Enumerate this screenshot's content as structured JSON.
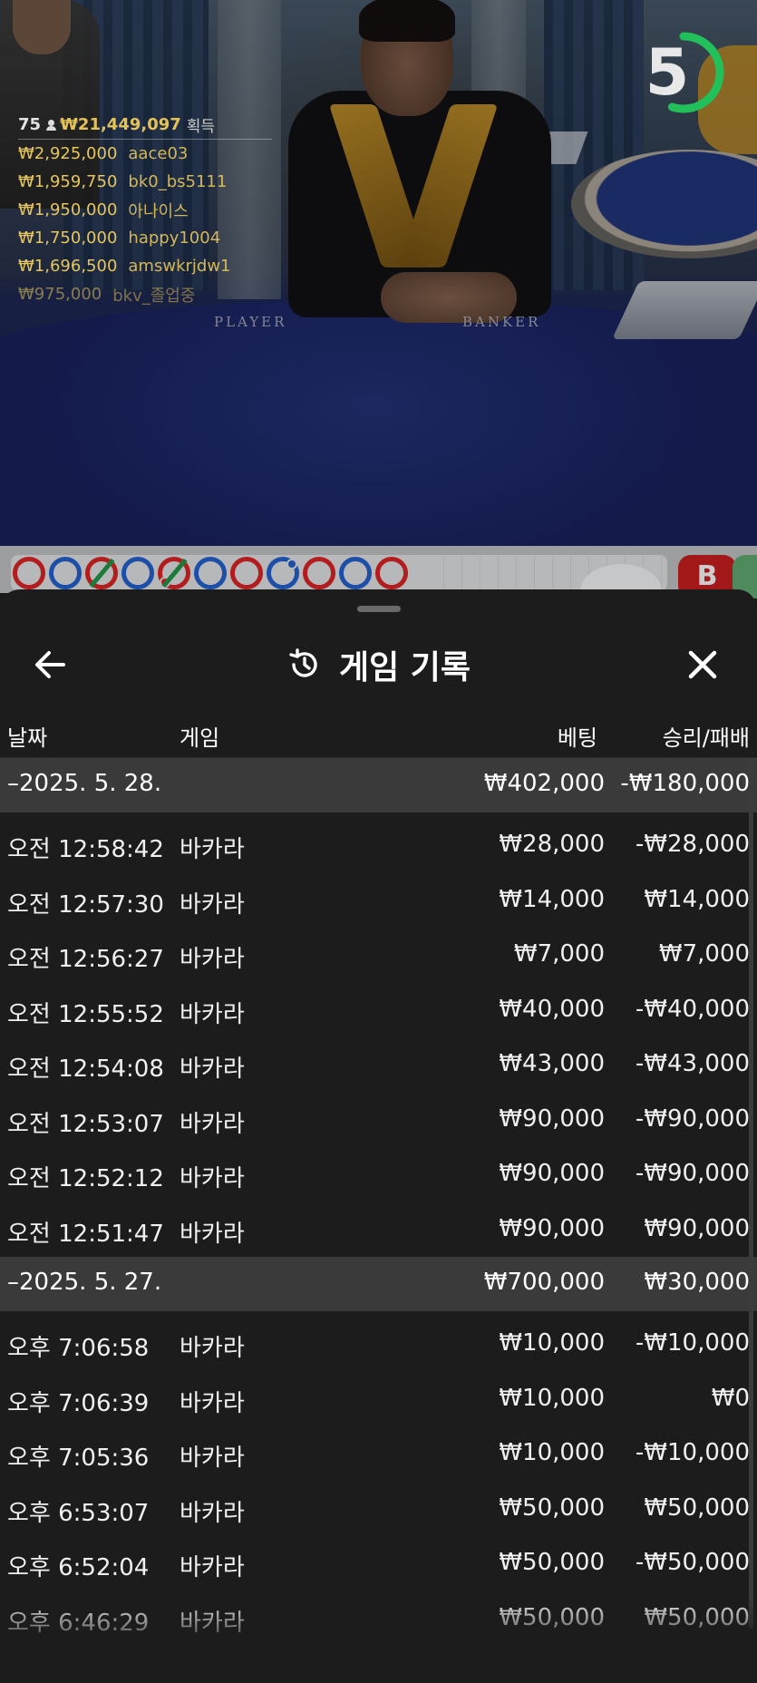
{
  "live": {
    "countdown": "5",
    "countdown_fraction": 0.55,
    "winners": {
      "player_count": "75",
      "total": "₩21,449,097",
      "total_suffix": "획득",
      "rows": [
        {
          "amount": "₩2,925,000",
          "nick": "aace03"
        },
        {
          "amount": "₩1,959,750",
          "nick": "bk0_bs5111"
        },
        {
          "amount": "₩1,950,000",
          "nick": "아나이스"
        },
        {
          "amount": "₩1,750,000",
          "nick": "happy1004"
        },
        {
          "amount": "₩1,696,500",
          "nick": "amswkrjdw1"
        },
        {
          "amount": "₩975,000",
          "nick": "bkv_졸업중"
        }
      ]
    },
    "table_labels": {
      "player": "PLAYER",
      "banker": "BANKER"
    },
    "road_badge": "B",
    "colors": {
      "banker": "#b31d1d",
      "player": "#1e4fa8",
      "tie": "#1e7a3a",
      "timer": "#22c05a"
    }
  },
  "sheet": {
    "title": "게임 기록",
    "back_icon": "arrow-left-icon",
    "history_icon": "history-icon",
    "close_icon": "close-icon",
    "columns": {
      "date": "날짜",
      "game": "게임",
      "bet": "베팅",
      "result": "승리/패배"
    },
    "groups": [
      {
        "date": "–2025. 5. 28.",
        "bet": "₩402,000",
        "result": "-₩180,000",
        "items": [
          {
            "time": "오전 12:58:42",
            "game": "바카라",
            "bet": "₩28,000",
            "result": "-₩28,000"
          },
          {
            "time": "오전 12:57:30",
            "game": "바카라",
            "bet": "₩14,000",
            "result": "₩14,000"
          },
          {
            "time": "오전 12:56:27",
            "game": "바카라",
            "bet": "₩7,000",
            "result": "₩7,000"
          },
          {
            "time": "오전 12:55:52",
            "game": "바카라",
            "bet": "₩40,000",
            "result": "-₩40,000"
          },
          {
            "time": "오전 12:54:08",
            "game": "바카라",
            "bet": "₩43,000",
            "result": "-₩43,000"
          },
          {
            "time": "오전 12:53:07",
            "game": "바카라",
            "bet": "₩90,000",
            "result": "-₩90,000"
          },
          {
            "time": "오전 12:52:12",
            "game": "바카라",
            "bet": "₩90,000",
            "result": "-₩90,000"
          },
          {
            "time": "오전 12:51:47",
            "game": "바카라",
            "bet": "₩90,000",
            "result": "₩90,000"
          }
        ]
      },
      {
        "date": "–2025. 5. 27.",
        "bet": "₩700,000",
        "result": "₩30,000",
        "items": [
          {
            "time": "오후 7:06:58",
            "game": "바카라",
            "bet": "₩10,000",
            "result": "-₩10,000"
          },
          {
            "time": "오후 7:06:39",
            "game": "바카라",
            "bet": "₩10,000",
            "result": "₩0"
          },
          {
            "time": "오후 7:05:36",
            "game": "바카라",
            "bet": "₩10,000",
            "result": "-₩10,000"
          },
          {
            "time": "오후 6:53:07",
            "game": "바카라",
            "bet": "₩50,000",
            "result": "₩50,000"
          },
          {
            "time": "오후 6:52:04",
            "game": "바카라",
            "bet": "₩50,000",
            "result": "-₩50,000"
          },
          {
            "time": "오후 6:46:29",
            "game": "바카라",
            "bet": "₩50,000",
            "result": "₩50,000"
          }
        ]
      }
    ]
  }
}
